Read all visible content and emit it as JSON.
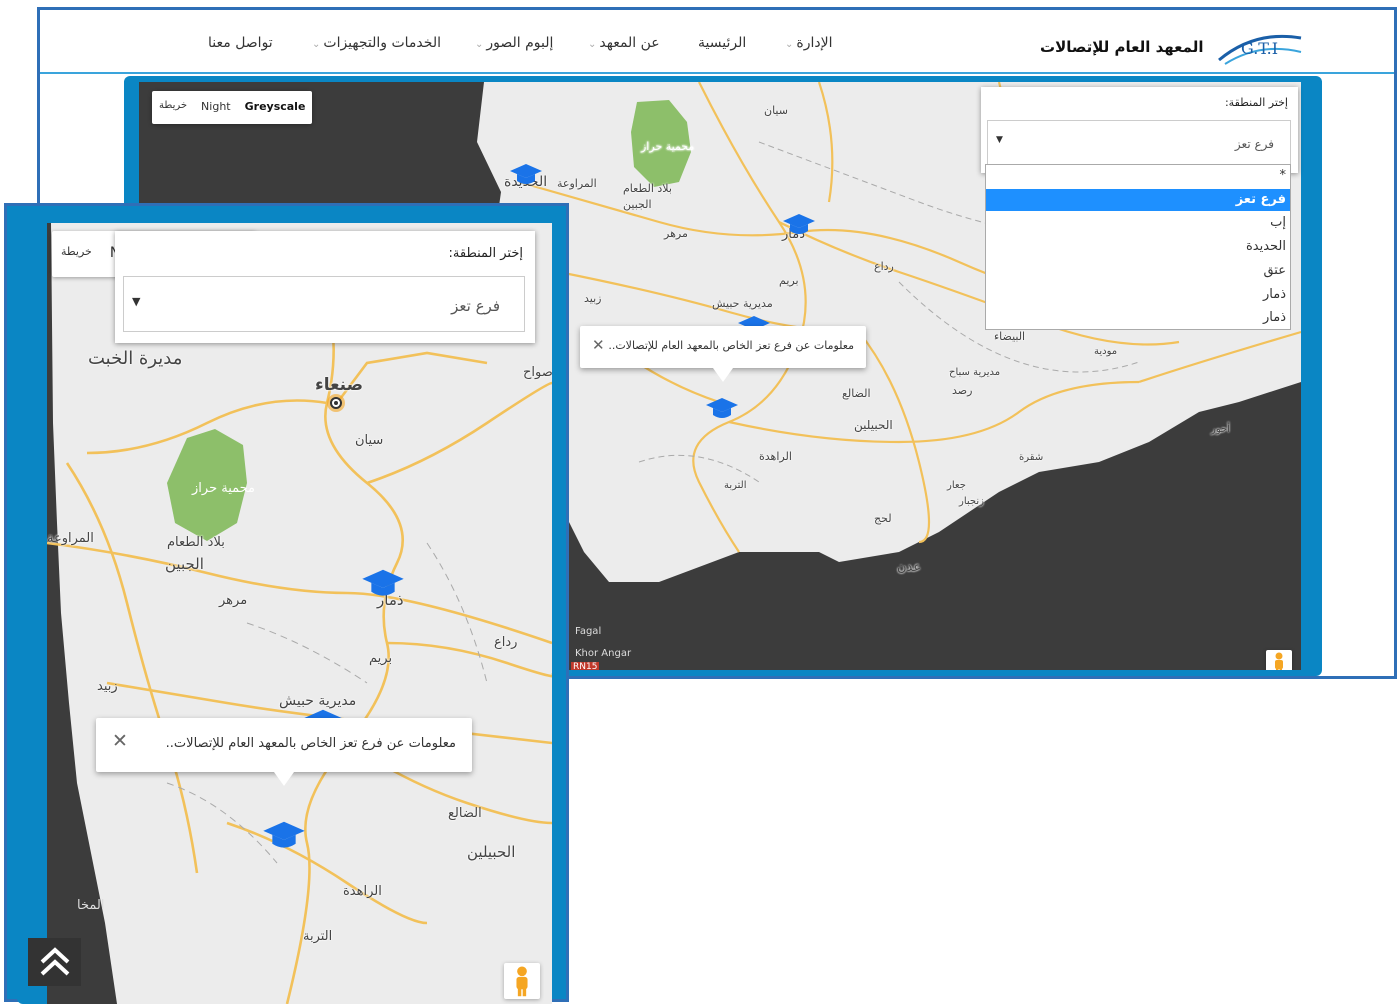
{
  "header": {
    "site_title": "المعهد العام للإتصالات",
    "logo_text": "G.T.I",
    "nav": [
      {
        "label": "الإدارة",
        "dropdown": true
      },
      {
        "label": "الرئيسية",
        "dropdown": false
      },
      {
        "label": "عن المعهد",
        "dropdown": true
      },
      {
        "label": "إلبوم الصور",
        "dropdown": true
      },
      {
        "label": "الخدمات والتجهيزات",
        "dropdown": true
      },
      {
        "label": "تواصل معنا",
        "dropdown": false
      }
    ]
  },
  "map_controls": {
    "map_type_buttons": [
      "خريطة",
      "Night",
      "Greyscale"
    ],
    "selected": "Greyscale"
  },
  "region_selector": {
    "label": "إختر المنطقة:",
    "selected_value": "فرع تعز",
    "options": [
      "*",
      "فرع تعز",
      "إب",
      "الحديدة",
      "عتق",
      "ذمار",
      "ذمار"
    ],
    "highlighted_option": "فرع تعز"
  },
  "info_window": {
    "text": "معلومات عن فرع تعز الخاص بالمعهد العام للإتصالات..",
    "close_symbol": "✕"
  },
  "map1_labels": [
    "الحديدة",
    "ذمار",
    "سيان",
    "محمية حراز",
    "بلاد الطعام",
    "الجبين",
    "مرهر",
    "المراوعة",
    "زبيد",
    "مديرية حبيش",
    "بريم",
    "رداع",
    "البيضاء",
    "مودية",
    "مديرية سباح",
    "رصد",
    "الضالع",
    "الحبيلين",
    "الراهدة",
    "التربة",
    "لحج",
    "عدن",
    "شقرة",
    "جعار",
    "زنجبار",
    "أحور",
    "Fagal",
    "Khor Angar",
    "RN15"
  ],
  "map2_labels": [
    "مديرة الخبت",
    "صنعاء",
    "سيان",
    "محمية حراز",
    "بلاد الطعام",
    "الجبين",
    "المراوعة",
    "مرهر",
    "ذمار",
    "رداع",
    "بريم",
    "زبيد",
    "مديرية حبيش",
    "صواح",
    "الضالع",
    "الحبيلين",
    "الراهدة",
    "التربة",
    "المخا"
  ],
  "colors": {
    "accent_blue": "#0a86c4",
    "frame_border": "#2f6fb7",
    "nav_underline": "#3aa4dc",
    "dropdown_highlight": "#1e90ff",
    "map_land": "#ececec",
    "map_sea": "#3c3c3c",
    "road": "#f2c15a",
    "park": "#8dbf6a",
    "marker": "#1a73e8"
  },
  "icons": [
    "graduation-cap-marker-icon",
    "pegman-icon",
    "close-icon",
    "dropdown-caret-icon",
    "scroll-top-chevrons-icon"
  ]
}
